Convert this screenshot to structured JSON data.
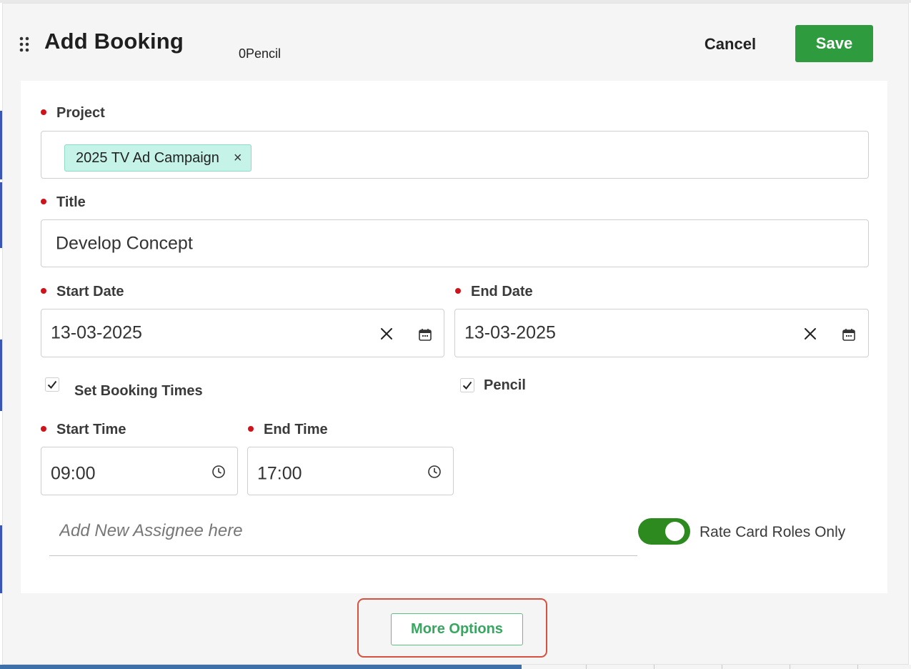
{
  "modal": {
    "title": "Add Booking",
    "subtitle": "0Pencil",
    "cancel_label": "Cancel",
    "save_label": "Save",
    "more_options_label": "More Options"
  },
  "form": {
    "project": {
      "label": "Project",
      "chip": "2025 TV Ad Campaign",
      "chip_remove": "×"
    },
    "title": {
      "label": "Title",
      "value": "Develop Concept"
    },
    "start_date": {
      "label": "Start Date",
      "value": "13-03-2025"
    },
    "end_date": {
      "label": "End Date",
      "value": "13-03-2025"
    },
    "set_booking_times": {
      "label": "Set Booking Times",
      "checked": true
    },
    "pencil": {
      "label": "Pencil",
      "checked": true
    },
    "start_time": {
      "label": "Start Time",
      "value": "09:00"
    },
    "end_time": {
      "label": "End Time",
      "value": "17:00"
    },
    "assignee": {
      "placeholder": "Add New Assignee here"
    },
    "rate_card_toggle": {
      "label": "Rate Card Roles Only",
      "on": true
    }
  },
  "icons": {
    "drag": "drag-handle-icon",
    "clear": "close-icon",
    "calendar": "calendar-icon",
    "clock": "clock-icon",
    "checkbox": "checkmark-icon"
  },
  "colors": {
    "save": "#2e9b3e",
    "required": "#d0121a",
    "chip_bg": "#c5f3e8",
    "toggle_on": "#2c8a1f",
    "more_options": "#39a660",
    "highlight": "#d6513f"
  }
}
